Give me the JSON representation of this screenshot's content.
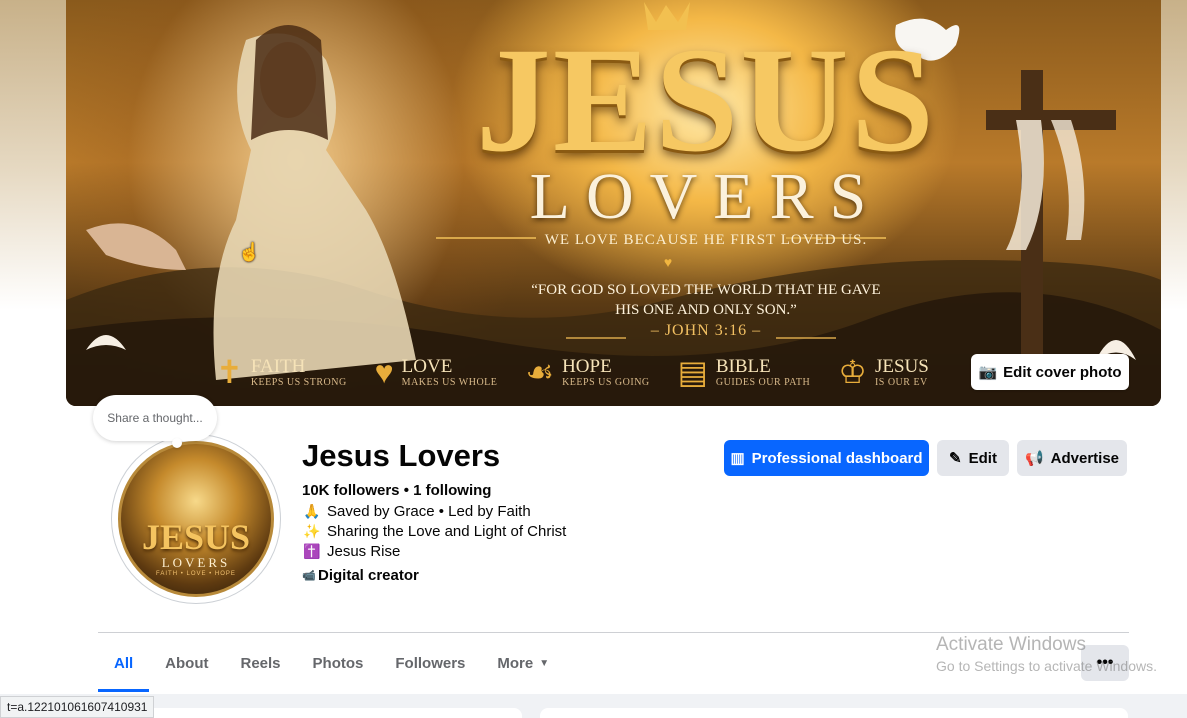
{
  "cover": {
    "title_big": "JESUS",
    "title_small": "LOVERS",
    "tagline": "WE LOVE BECAUSE HE FIRST LOVED US.",
    "quote_line1": "“FOR GOD SO LOVED THE WORLD THAT HE GAVE",
    "quote_line2": "HIS ONE AND ONLY SON.”",
    "verse": "– JOHN 3:16 –",
    "values": [
      {
        "title": "FAITH",
        "sub": "KEEPS US STRONG",
        "icon": "cross-icon"
      },
      {
        "title": "LOVE",
        "sub": "MAKES US WHOLE",
        "icon": "heart-icon"
      },
      {
        "title": "HOPE",
        "sub": "KEEPS US GOING",
        "icon": "praying-hands-icon"
      },
      {
        "title": "BIBLE",
        "sub": "GUIDES OUR PATH",
        "icon": "bible-icon"
      },
      {
        "title": "JESUS",
        "sub": "IS OUR EV",
        "icon": "crown-icon"
      }
    ],
    "edit_cover_label": "Edit cover photo"
  },
  "profile": {
    "thought_placeholder": "Share a thought...",
    "avatar": {
      "title": "JESUS",
      "sub": "LOVERS",
      "tiny": "FAITH • LOVE • HOPE"
    },
    "name": "Jesus Lovers",
    "stats": "10K followers • 1 following",
    "bio": [
      {
        "emoji": "🙏",
        "text": "Saved by Grace • Led by Faith"
      },
      {
        "emoji": "✨",
        "text": "Sharing the Love and Light of Christ"
      },
      {
        "emoji": "✝️",
        "text": "Jesus Rise"
      }
    ],
    "category_icon": "📹",
    "category": "Digital creator"
  },
  "actions": {
    "professional_dashboard": "Professional dashboard",
    "edit": "Edit",
    "advertise": "Advertise"
  },
  "tabs": [
    {
      "label": "All",
      "active": true
    },
    {
      "label": "About"
    },
    {
      "label": "Reels"
    },
    {
      "label": "Photos"
    },
    {
      "label": "Followers"
    },
    {
      "label": "More"
    }
  ],
  "more_options": "•••",
  "watermark": {
    "line1": "Activate Windows",
    "line2": "Go to Settings to activate Windows."
  },
  "status_url": "t=a.122101061607410931",
  "colors": {
    "primary": "#0866ff",
    "secondary_btn": "#e4e6eb",
    "text": "#050505",
    "muted": "#65676b"
  }
}
